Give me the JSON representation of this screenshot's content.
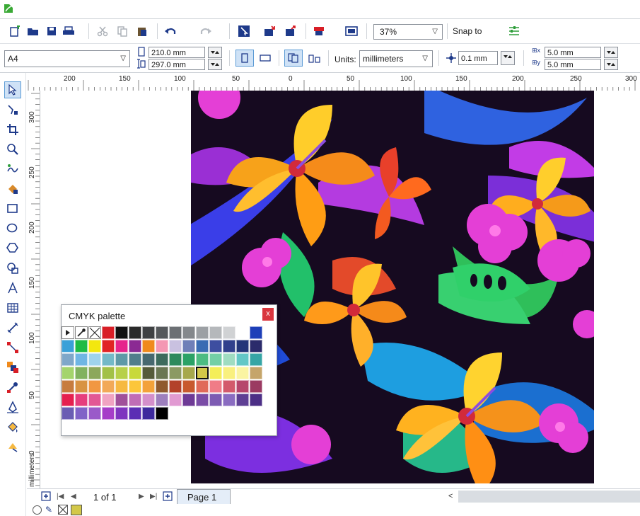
{
  "toolbar": {
    "zoom": "37%",
    "snap_to": "Snap to"
  },
  "property_bar": {
    "page_size": "A4",
    "width": "210.0 mm",
    "height": "297.0 mm",
    "units_label": "Units:",
    "units_value": "millimeters",
    "nudge": "0.1 mm",
    "dup_x": "5.0 mm",
    "dup_y": "5.0 mm"
  },
  "ruler": {
    "h_labels": [
      "200",
      "150",
      "100",
      "50",
      "0",
      "50",
      "100",
      "150",
      "200",
      "250",
      "300"
    ],
    "v_labels": [
      "300",
      "250",
      "200",
      "150",
      "100",
      "50",
      "0"
    ],
    "unit": "millimeters"
  },
  "palette": {
    "title": "CMYK palette",
    "close": "x",
    "rows": [
      [
        "#ffffff",
        "#ffffff",
        "#ffffff",
        "#d81e26",
        "#111111",
        "#2a2a2a",
        "#3f4143",
        "#55585b",
        "#6c7074",
        "#84888c",
        "#9ca0a4",
        "#b5b8bb",
        "#d0d2d4",
        "#ffffff",
        "#1d3fb8"
      ],
      [
        "#3aa0d8",
        "#1dbb45",
        "#f3e70f",
        "#e12424",
        "#e6248c",
        "#8b2a93",
        "#f08a1c",
        "#f497b3",
        "#c9c1e0",
        "#6f7fb8",
        "#3a6cb3",
        "#3d4ea0",
        "#31408c",
        "#243579",
        "#2b2b6b"
      ],
      [
        "#7fa7c9",
        "#6fb6e4",
        "#9fd3ec",
        "#74b9c7",
        "#5f99a7",
        "#517e8b",
        "#47686f",
        "#3d6b5d",
        "#2d8a5c",
        "#2aa266",
        "#4cbc82",
        "#73cfa6",
        "#9fdcc1",
        "#63c7c6",
        "#36a5a5"
      ],
      [
        "#a4d46c",
        "#81b25f",
        "#8ca85b",
        "#a2c148",
        "#b7d04a",
        "#c8d93a",
        "#555b3a",
        "#6a7753",
        "#8b9a63",
        "#a6a84c",
        "#d4cb52",
        "#f4ee59",
        "#f9f07e",
        "#faf4a2",
        "#c5a56a"
      ],
      [
        "#c77c3e",
        "#d89342",
        "#f19742",
        "#f2a957",
        "#f6b941",
        "#fcc63a",
        "#f3a23a",
        "#8f5a2e",
        "#b3412a",
        "#c8592e",
        "#e06a5a",
        "#f07c87",
        "#d35a6c",
        "#b6466c",
        "#9b3a62"
      ],
      [
        "#e5204f",
        "#e63d7d",
        "#e25895",
        "#f0a3c2",
        "#a0509a",
        "#c06db6",
        "#d48fcb",
        "#9d7fbd",
        "#e19ad2",
        "#6e3a96",
        "#7a4ca6",
        "#7d5bb3",
        "#8a6cc1",
        "#5e3f94",
        "#4c2f86"
      ],
      [
        "#6a5db3",
        "#8062c7",
        "#9a5ac9",
        "#a63dc8",
        "#7f34bf",
        "#5b2eb4",
        "#3d2a9d",
        "#000000"
      ]
    ],
    "selected_color": "#d3c849"
  },
  "pagenav": {
    "page_of": "1 of 1",
    "page_tab": "Page 1"
  },
  "status": {
    "current_fill": "#d3c849"
  }
}
